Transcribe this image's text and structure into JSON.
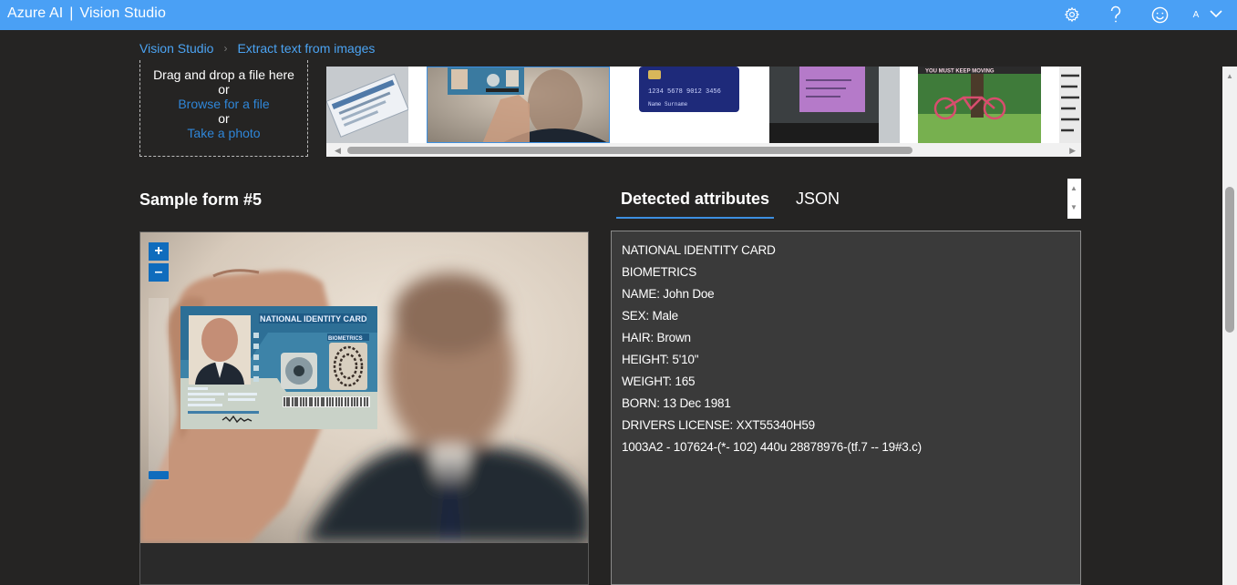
{
  "app": {
    "brand": "Azure AI",
    "separator": "|",
    "title": "Vision Studio",
    "avatar_initial": "A",
    "icons": [
      "settings-icon",
      "help-icon",
      "feedback-smiley-icon",
      "chevron-down-icon"
    ]
  },
  "breadcrumb": {
    "items": [
      "Vision Studio",
      "Extract text from images"
    ]
  },
  "upload": {
    "drag_text": "Drag and drop a file here",
    "or1": "or",
    "browse_link": "Browse for a file",
    "or2": "or",
    "photo_link": "Take a photo"
  },
  "gallery": {
    "selected_index": 1,
    "card_text_1": "1234 5678 9012 3456",
    "card_text_2": "Name Surname",
    "sign_text": "YOU MUST KEEP MOVING"
  },
  "sample": {
    "title": "Sample form #5",
    "card_title": "NATIONAL IDENTITY CARD",
    "card_biometrics": "BIOMETRICS"
  },
  "zoom": {
    "in_label": "+",
    "out_label": "–"
  },
  "tabs": [
    {
      "label": "Detected attributes",
      "active": true
    },
    {
      "label": "JSON",
      "active": false
    }
  ],
  "results": {
    "lines": [
      "NATIONAL IDENTITY CARD",
      "BIOMETRICS",
      "NAME: John Doe",
      "SEX: Male",
      "HAIR: Brown",
      "HEIGHT: 5'10\"",
      "WEIGHT: 165",
      "BORN: 13 Dec 1981",
      "DRIVERS LICENSE: XXT55340H59",
      "1003A2 - 107624-(*- 102) 440u 28878976-(tf.7 -- 19#3.c)"
    ]
  },
  "colors": {
    "topbar": "#4aa0f5",
    "background": "#252423",
    "link": "#4ba3f2",
    "accent": "#0f6cbd"
  }
}
